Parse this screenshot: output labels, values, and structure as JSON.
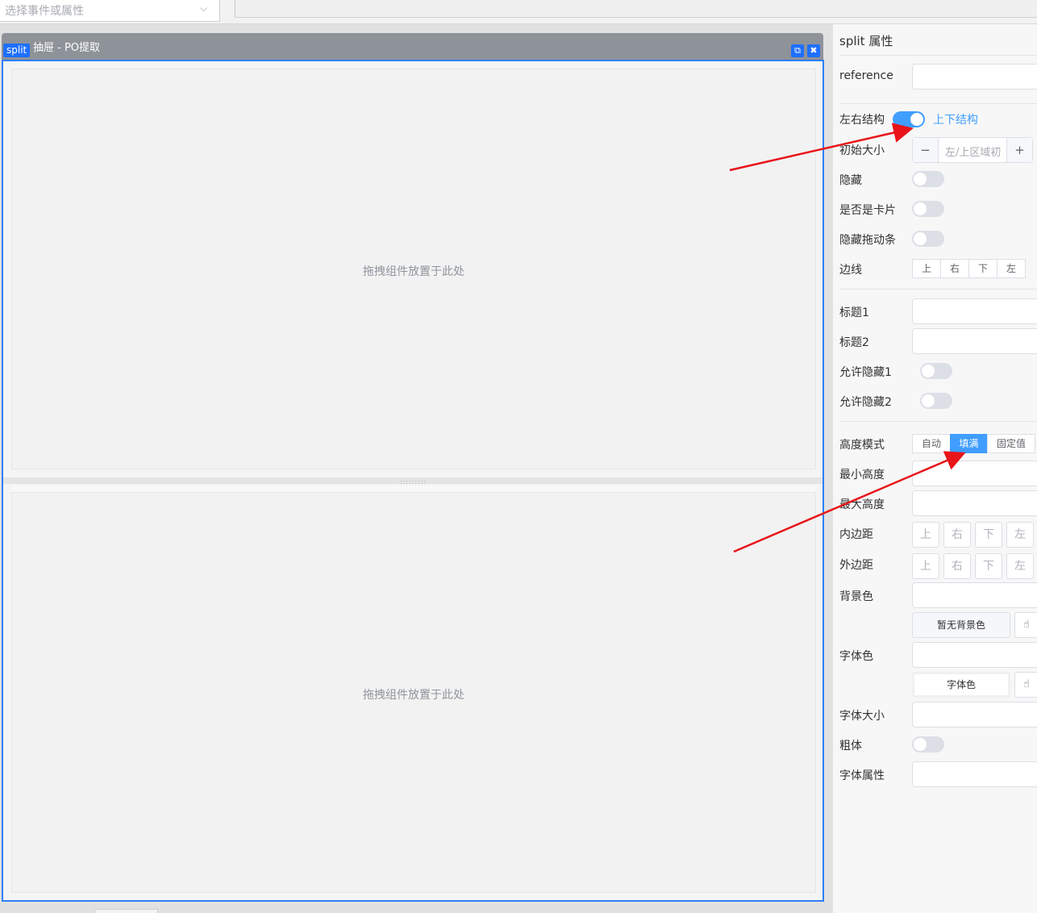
{
  "topbar": {
    "selector_placeholder": "选择事件或属性"
  },
  "canvas": {
    "tag": "split",
    "title": "抽屉 - PO提取",
    "top_pane_text": "拖拽组件放置于此处",
    "bottom_pane_text": "拖拽组件放置于此处"
  },
  "panel": {
    "title": "split 属性",
    "reference_label": "reference",
    "layout_left_label": "左右结构",
    "layout_right_label": "上下结构",
    "layout_vertical": true,
    "initial_size_label": "初始大小",
    "initial_size_placeholder": "左/上区域初",
    "hidden_label": "隐藏",
    "card_label": "是否是卡片",
    "hide_drag_label": "隐藏拖动条",
    "border_label": "边线",
    "border_sides": [
      "上",
      "右",
      "下",
      "左"
    ],
    "title1_label": "标题1",
    "title2_label": "标题2",
    "allow_hide1_label": "允许隐藏1",
    "allow_hide2_label": "允许隐藏2",
    "height_mode_label": "高度模式",
    "height_modes": [
      "自动",
      "填满",
      "固定值"
    ],
    "height_mode_selected": "填满",
    "min_height_label": "最小高度",
    "max_height_label": "最大高度",
    "padding_label": "内边距",
    "margin_label": "外边距",
    "sides": [
      "上",
      "右",
      "下",
      "左"
    ],
    "bg_color_label": "背景色",
    "bg_color_button": "暂无背景色",
    "font_color_label": "字体色",
    "font_color_button": "字体色",
    "font_size_label": "字体大小",
    "bold_label": "粗体",
    "font_attr_label": "字体属性"
  },
  "colors": {
    "accent": "#409eff",
    "selection": "#2d7ff9",
    "annotation_arrow": "#e8141a"
  }
}
